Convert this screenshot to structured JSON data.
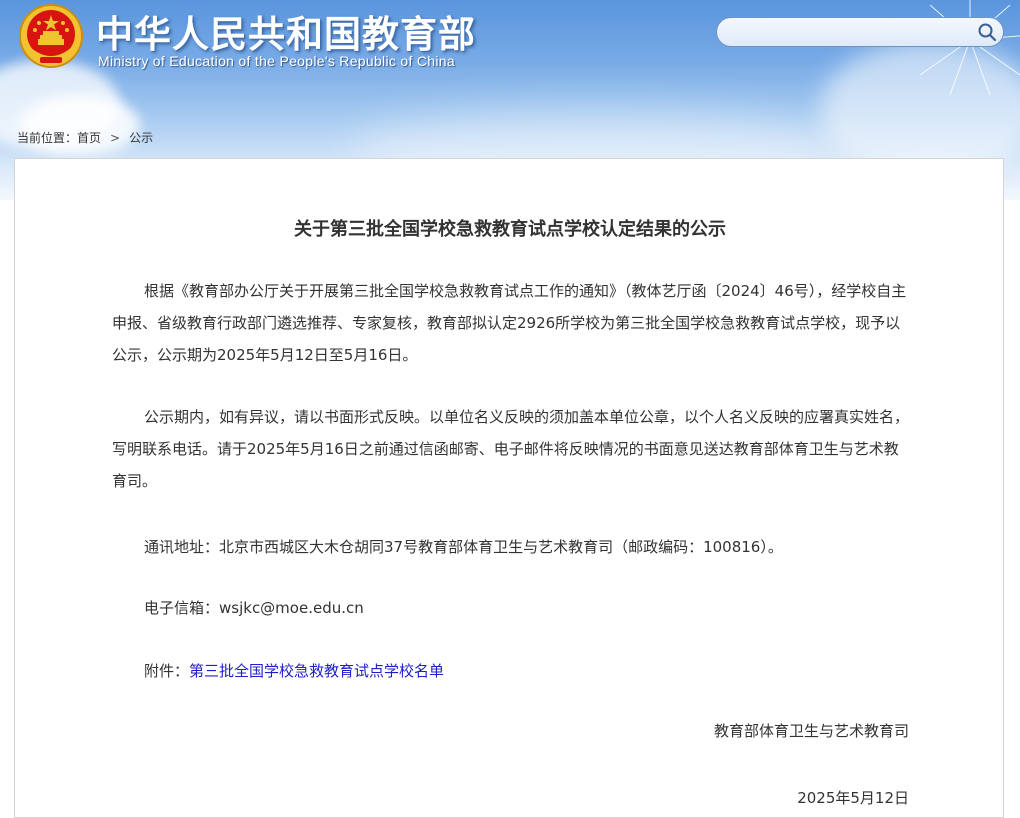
{
  "header": {
    "site_title": "中华人民共和国教育部",
    "site_subtitle": "Ministry of Education of the People's Republic of China",
    "search": {
      "value": "",
      "placeholder": ""
    }
  },
  "breadcrumb": {
    "prefix": "当前位置：",
    "items": [
      "首页",
      "公示"
    ],
    "separator": ">"
  },
  "article": {
    "title": "关于第三批全国学校急救教育试点学校认定结果的公示",
    "paragraph1": "根据《教育部办公厅关于开展第三批全国学校急救教育试点工作的通知》（教体艺厅函〔2024〕46号），经学校自主申报、省级教育行政部门遴选推荐、专家复核，教育部拟认定2926所学校为第三批全国学校急救教育试点学校，现予以公示，公示期为2025年5月12日至5月16日。",
    "paragraph2": "公示期内，如有异议，请以书面形式反映。以单位名义反映的须加盖本单位公章，以个人名义反映的应署真实姓名，写明联系电话。请于2025年5月16日之前通过信函邮寄、电子邮件将反映情况的书面意见送达教育部体育卫生与艺术教育司。",
    "address": "通讯地址：北京市西城区大木仓胡同37号教育部体育卫生与艺术教育司（邮政编码：100816）。",
    "email": "电子信箱：wsjkc@moe.edu.cn",
    "attachment_label": "附件：",
    "attachment_link": "第三批全国学校急救教育试点学校名单",
    "signature": "教育部体育卫生与艺术教育司",
    "date": "2025年5月12日"
  },
  "colors": {
    "header_top": "#5a95dd",
    "link": "#2020c8",
    "text": "#333333",
    "emblem_red": "#d7140f",
    "emblem_gold": "#f2c330"
  },
  "icons": [
    "national-emblem-icon",
    "search-icon",
    "dandelion-decoration"
  ]
}
